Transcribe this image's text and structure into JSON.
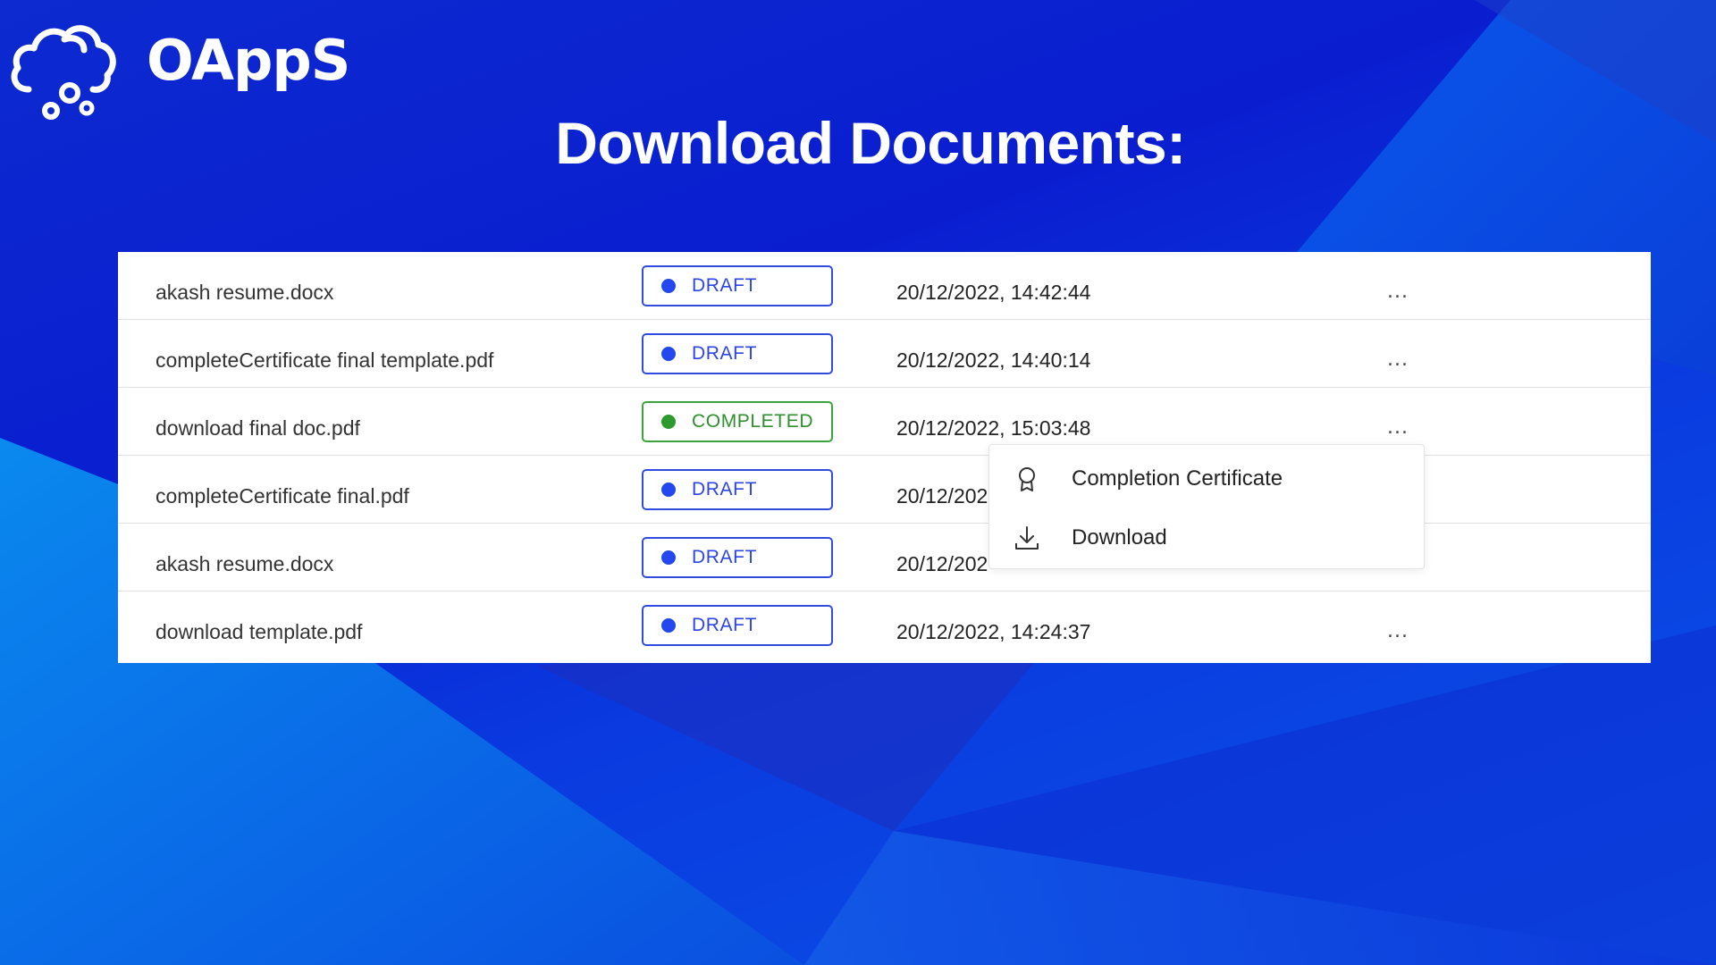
{
  "brand": {
    "name": "OAppS"
  },
  "page": {
    "title": "Download Documents:"
  },
  "colors": {
    "draft_accent": "#2d45e6",
    "completed_accent": "#2f8f2f",
    "background_blue": "#0a1ed0"
  },
  "documents": [
    {
      "name": "akash resume.docx",
      "status": "DRAFT",
      "date": "20/12/2022, 14:42:44",
      "menu": "..."
    },
    {
      "name": "completeCertificate final template.pdf",
      "status": "DRAFT",
      "date": "20/12/2022, 14:40:14",
      "menu": "..."
    },
    {
      "name": "download final doc.pdf",
      "status": "COMPLETED",
      "date": "20/12/2022, 15:03:48",
      "menu": "..."
    },
    {
      "name": "completeCertificate final.pdf",
      "status": "DRAFT",
      "date": "20/12/202",
      "menu": ""
    },
    {
      "name": "akash resume.docx",
      "status": "DRAFT",
      "date": "20/12/202",
      "menu": ""
    },
    {
      "name": "download template.pdf",
      "status": "DRAFT",
      "date": "20/12/2022, 14:24:37",
      "menu": "..."
    }
  ],
  "context_menu": {
    "items": [
      {
        "label": "Completion Certificate",
        "icon": "award-icon"
      },
      {
        "label": "Download",
        "icon": "download-icon"
      }
    ]
  }
}
